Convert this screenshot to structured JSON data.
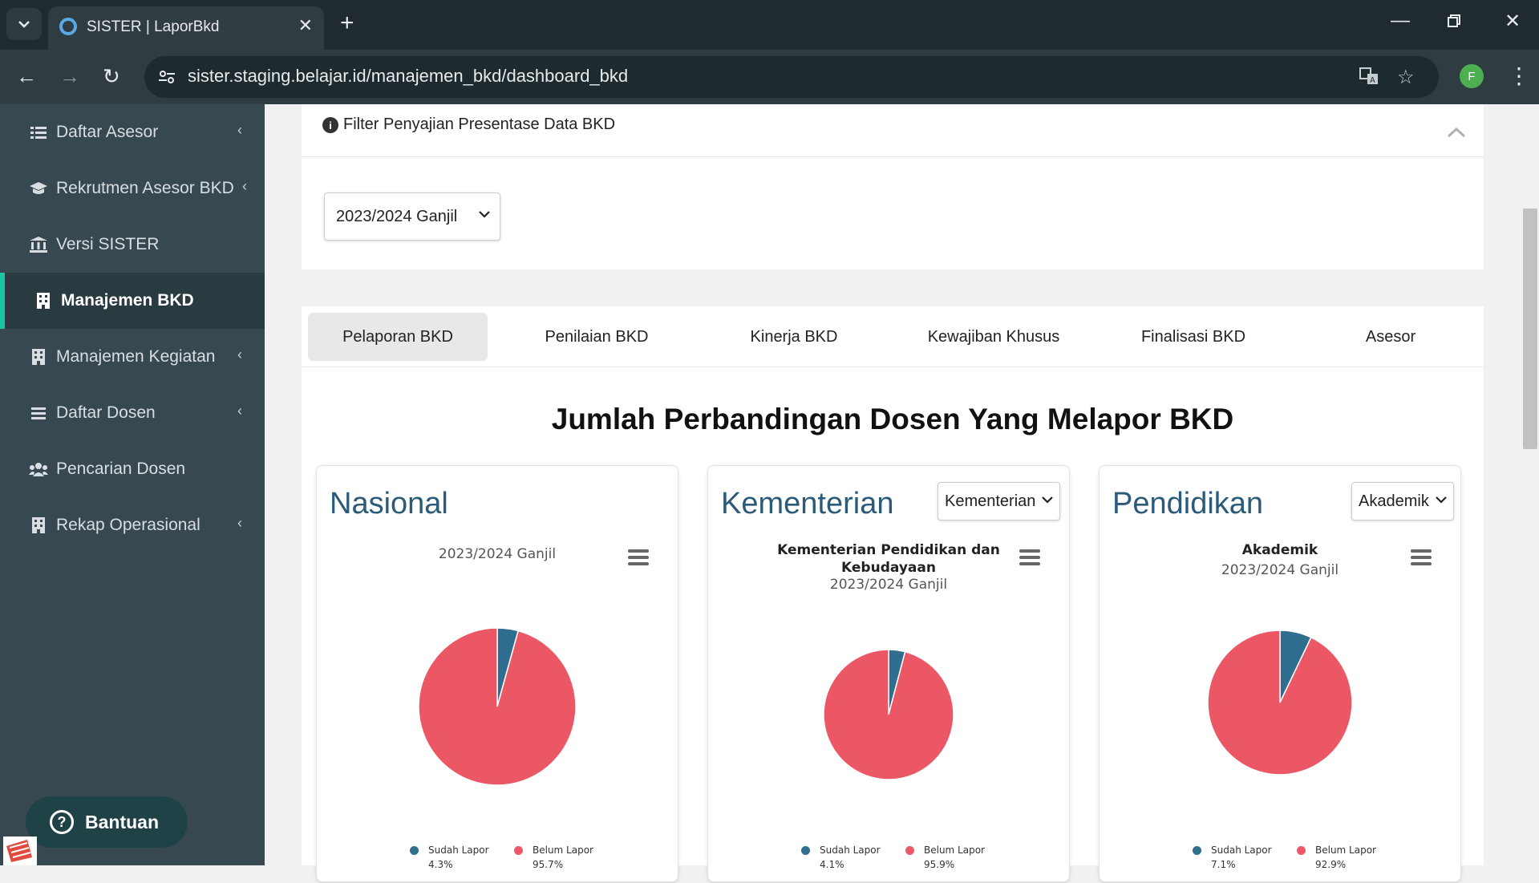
{
  "browser": {
    "tab_title": "SISTER | LaporBkd",
    "url": "sister.staging.belajar.id/manajemen_bkd/dashboard_bkd",
    "profile_initial": "F"
  },
  "sidebar": {
    "items": [
      {
        "label": "Daftar Asesor",
        "icon": "list-icon",
        "has_chevron": true
      },
      {
        "label": "Rekrutmen Asesor BKD",
        "icon": "graduation-cap-icon",
        "has_chevron": true
      },
      {
        "label": "Versi SISTER",
        "icon": "bank-icon",
        "has_chevron": false
      },
      {
        "label": "Manajemen BKD",
        "icon": "building-icon",
        "has_chevron": false,
        "active": true
      },
      {
        "label": "Manajemen Kegiatan",
        "icon": "building-icon",
        "has_chevron": true
      },
      {
        "label": "Daftar Dosen",
        "icon": "bars-icon",
        "has_chevron": true
      },
      {
        "label": "Pencarian Dosen",
        "icon": "users-icon",
        "has_chevron": false
      },
      {
        "label": "Rekap Operasional",
        "icon": "building-icon",
        "has_chevron": true
      }
    ],
    "help_label": "Bantuan"
  },
  "filter": {
    "title": "Filter Penyajian Presentase Data BKD",
    "semester_value": "2023/2024 Ganjil"
  },
  "tabs": [
    "Pelaporan BKD",
    "Penilaian BKD",
    "Kinerja BKD",
    "Kewajiban Khusus",
    "Finalisasi BKD",
    "Asesor"
  ],
  "section_title": "Jumlah Perbandingan Dosen Yang Melapor BKD",
  "cards": [
    {
      "heading": "Nasional",
      "dropdown": null,
      "chart_title": "",
      "subtitle": "2023/2024 Ganjil"
    },
    {
      "heading": "Kementerian",
      "dropdown": "Kementerian",
      "chart_title_1": "Kementerian Pendidikan dan",
      "chart_title_2": "Kebudayaan",
      "subtitle": "2023/2024 Ganjil"
    },
    {
      "heading": "Pendidikan",
      "dropdown": "Akademik",
      "chart_title": "Akademik",
      "subtitle": "2023/2024 Ganjil"
    }
  ],
  "colors": {
    "sudah": "#2f6e8e",
    "belum": "#ec5766",
    "sidebar_bg": "#374850",
    "accent": "#1bc5a2"
  },
  "chart_data": [
    {
      "type": "pie",
      "subtitle": "2023/2024 Ganjil",
      "slices": [
        {
          "name": "Sudah Lapor",
          "value": 4.3,
          "label": "4.3%"
        },
        {
          "name": "Belum Lapor",
          "value": 95.7,
          "label": "95.7%"
        }
      ]
    },
    {
      "type": "pie",
      "title": "Kementerian Pendidikan dan Kebudayaan",
      "subtitle": "2023/2024 Ganjil",
      "slices": [
        {
          "name": "Sudah Lapor",
          "value": 4.1,
          "label": "4.1%"
        },
        {
          "name": "Belum Lapor",
          "value": 95.9,
          "label": "95.9%"
        }
      ]
    },
    {
      "type": "pie",
      "title": "Akademik",
      "subtitle": "2023/2024 Ganjil",
      "slices": [
        {
          "name": "Sudah Lapor",
          "value": 7.1,
          "label": "7.1%"
        },
        {
          "name": "Belum Lapor",
          "value": 92.9,
          "label": "92.9%"
        }
      ]
    }
  ]
}
